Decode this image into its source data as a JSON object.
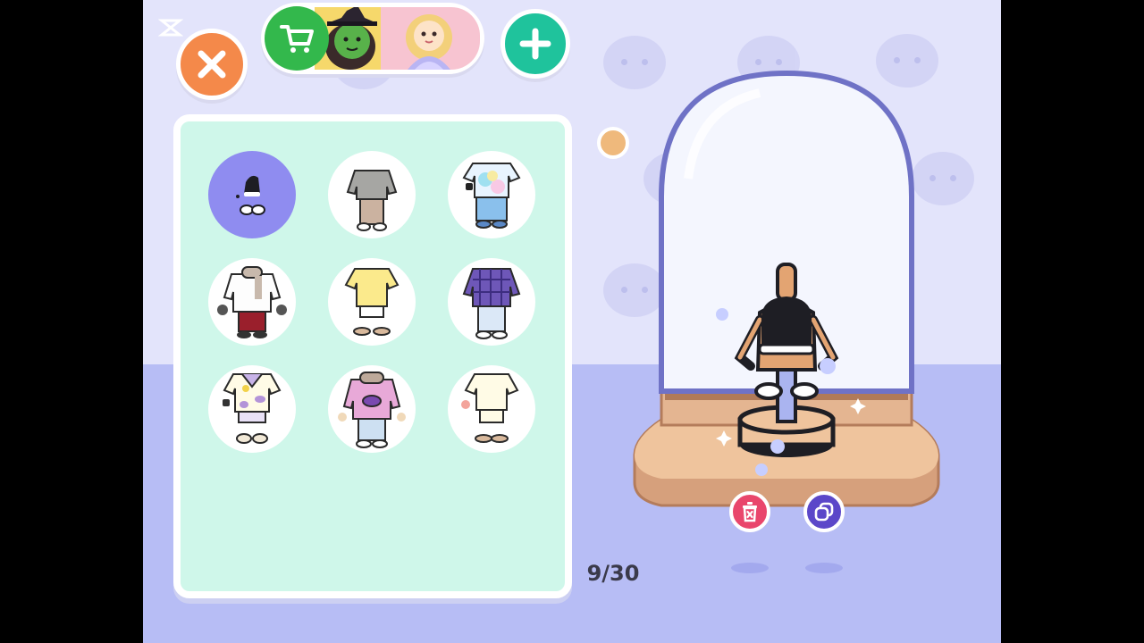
{
  "toolbar": {
    "close_icon": "close-x-icon",
    "cart_icon": "shopping-cart-icon",
    "add_icon": "plus-icon",
    "banner": "character-pack-promo",
    "colors": {
      "close": "#f4894a",
      "cart": "#33b84c",
      "add": "#1fc39c"
    }
  },
  "wardrobe": {
    "outfits": [
      {
        "name": "empty-outfit",
        "selected": true
      },
      {
        "name": "grey-sweater-outfit",
        "selected": false
      },
      {
        "name": "tie-dye-tee-jeans-outfit",
        "selected": false
      },
      {
        "name": "white-jacket-scarf-outfit",
        "selected": false
      },
      {
        "name": "yellow-tee-sandals-outfit",
        "selected": false
      },
      {
        "name": "purple-plaid-jacket-outfit",
        "selected": false
      },
      {
        "name": "cow-print-tee-outfit",
        "selected": false
      },
      {
        "name": "pink-hoodie-scarf-outfit",
        "selected": false
      },
      {
        "name": "cream-tee-shorts-outfit",
        "selected": false
      }
    ],
    "count_label": "9/30",
    "panel_color": "#cff7ea",
    "selected_color": "#8f8cf0"
  },
  "display": {
    "delete_icon": "trash-icon",
    "duplicate_icon": "copy-icon",
    "colors": {
      "delete": "#e9466c",
      "duplicate": "#5b47c9"
    }
  }
}
